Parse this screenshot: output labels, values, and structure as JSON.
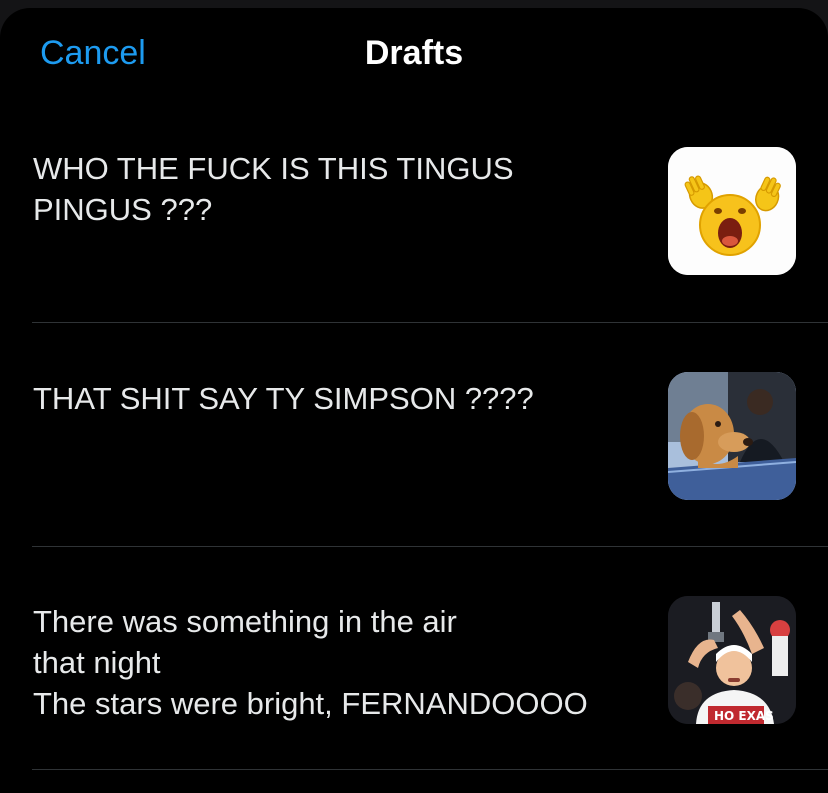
{
  "nav": {
    "cancel_label": "Cancel",
    "title": "Drafts"
  },
  "drafts": [
    {
      "text": "WHO THE FUCK IS THIS TINGUS\nPINGUS ???",
      "thumbnail": "screaming-emoji-icon"
    },
    {
      "text": "THAT SHIT SAY TY SIMPSON ????",
      "thumbnail": "dog-in-car-photo"
    },
    {
      "text": "There was something in the air\nthat night\nThe stars were bright, FERNANDOOOO",
      "thumbnail": "football-player-trophy-photo"
    }
  ],
  "colors": {
    "background": "#000000",
    "accent": "#1d9bf0",
    "text": "#e7e9ea",
    "divider": "#2f3336"
  }
}
